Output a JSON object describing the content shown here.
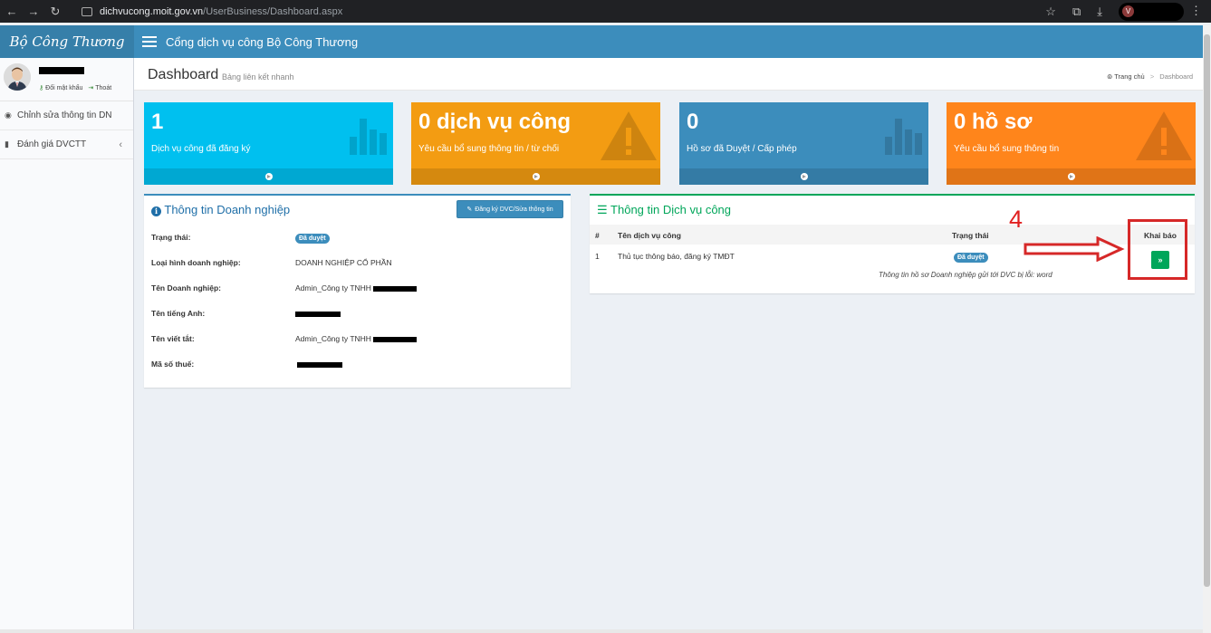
{
  "browser": {
    "url_host": "dichvucong.moit.gov.vn",
    "url_path": "/UserBusiness/Dashboard.aspx",
    "profile_initial": "V"
  },
  "header": {
    "logo_text": "Bộ Công Thương",
    "title": "Cổng dịch vụ công Bộ Công Thương"
  },
  "sidebar": {
    "user_links": [
      "Đổi mật khẩu",
      "Thoát"
    ],
    "items": [
      {
        "label": "Chỉnh sửa thông tin DN"
      },
      {
        "label": "Đánh giá DVCTT"
      }
    ]
  },
  "page": {
    "title": "Dashboard",
    "subtitle": "Bảng liên kết nhanh",
    "breadcrumb_home": "Trang chủ",
    "breadcrumb_current": "Dashboard"
  },
  "tiles": [
    {
      "value": "1",
      "text": "Dịch vụ công đã đăng ký",
      "color": "#00c0ef"
    },
    {
      "value": "0 dịch vụ công",
      "text": "Yêu cầu bổ sung thông tin / từ chối",
      "color": "#f39c12"
    },
    {
      "value": "0",
      "text": "Hồ sơ đã Duyệt / Cấp phép",
      "color": "#3c8dbc"
    },
    {
      "value": "0 hồ sơ",
      "text": "Yêu cầu bổ sung thông tin",
      "color": "#ff851b"
    }
  ],
  "company_panel": {
    "title": "Thông tin Doanh nghiệp",
    "edit_button": "Đăng ký DVC/Sửa thông tin",
    "rows": [
      {
        "label": "Trạng thái:",
        "value": "Đã duyệt"
      },
      {
        "label": "Loại hình doanh nghiệp:",
        "value": "DOANH NGHIỆP CỔ PHẦN"
      },
      {
        "label": "Tên Doanh nghiệp:",
        "value": "Admin_Công ty TNHH"
      },
      {
        "label": "Tên tiếng Anh:",
        "value": ""
      },
      {
        "label": "Tên viết tắt:",
        "value": "Admin_Công ty TNHH"
      },
      {
        "label": "Mã số thuế:",
        "value": ""
      }
    ]
  },
  "service_panel": {
    "title": "Thông tin Dịch vụ công",
    "columns": [
      "#",
      "Tên dịch vụ công",
      "Trạng thái",
      "Khai báo"
    ],
    "rows": [
      {
        "index": "1",
        "name": "Thủ tục thông báo, đăng ký TMĐT",
        "status": "Đã duyệt",
        "action": "»"
      }
    ],
    "note": "Thông tin hồ sơ Doanh nghiệp gửi tới DVC bị lỗi: word"
  },
  "annotation": {
    "step": "4",
    "color": "#d62828"
  }
}
